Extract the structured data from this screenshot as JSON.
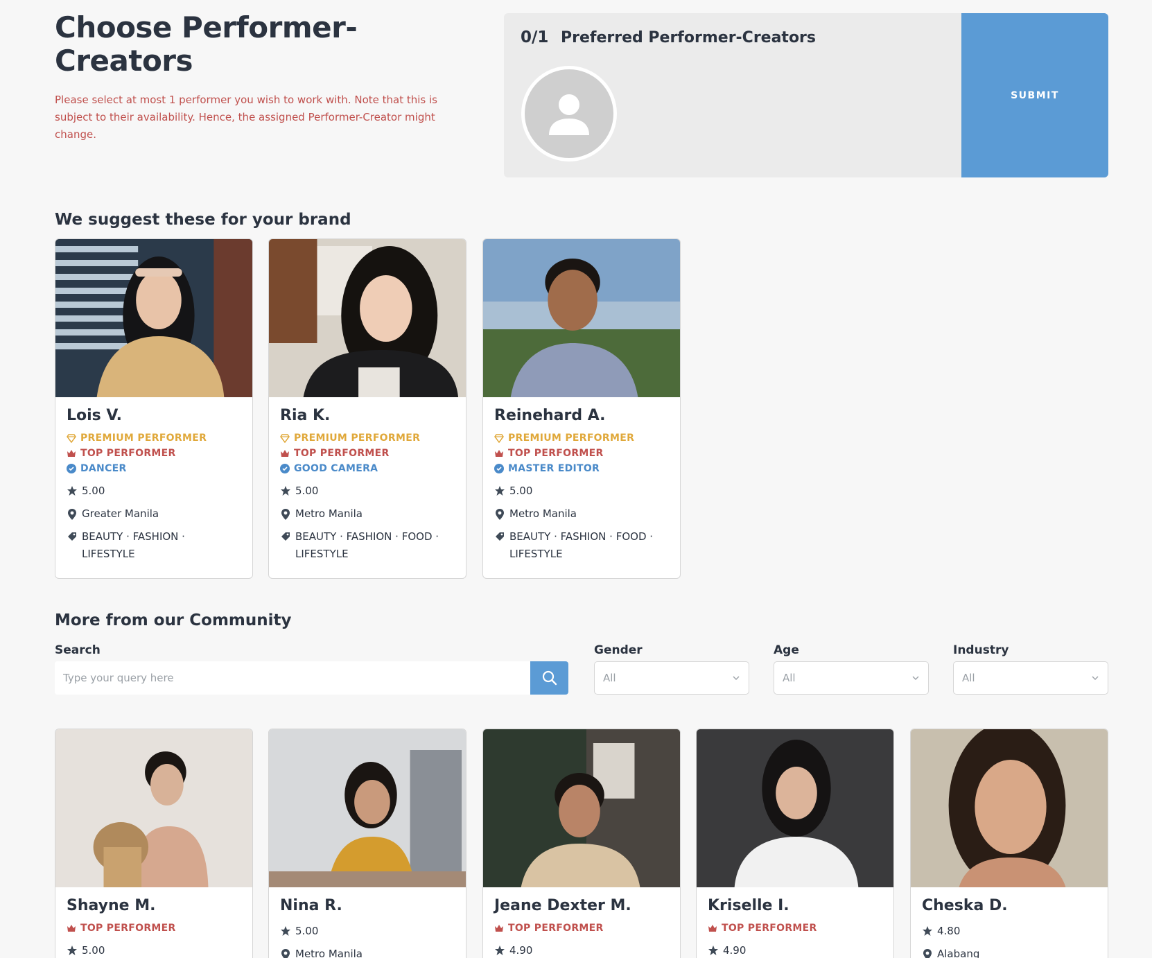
{
  "header": {
    "title": "Choose Performer-Creators",
    "notice": "Please select at most 1 performer you wish to work with. Note that this is subject to their availability. Hence, the assigned Performer-Creator might change."
  },
  "preferred": {
    "count": "0/1",
    "label": "Preferred Performer-Creators",
    "submit_label": "SUBMIT"
  },
  "suggested": {
    "title": "We suggest these for your brand",
    "cards": [
      {
        "name": "Lois V.",
        "premium": "PREMIUM PERFORMER",
        "top": "TOP PERFORMER",
        "skill": "DANCER",
        "rating": "5.00",
        "location": "Greater Manila",
        "tags": "BEAUTY · FASHION · LIFESTYLE"
      },
      {
        "name": "Ria K.",
        "premium": "PREMIUM PERFORMER",
        "top": "TOP PERFORMER",
        "skill": "GOOD CAMERA",
        "rating": "5.00",
        "location": "Metro Manila",
        "tags": "BEAUTY · FASHION · FOOD · LIFESTYLE"
      },
      {
        "name": "Reinehard A.",
        "premium": "PREMIUM PERFORMER",
        "top": "TOP PERFORMER",
        "skill": "MASTER EDITOR",
        "rating": "5.00",
        "location": "Metro Manila",
        "tags": "BEAUTY · FASHION · FOOD · LIFESTYLE"
      }
    ]
  },
  "community": {
    "title": "More from our Community",
    "search_label": "Search",
    "search_placeholder": "Type your query here",
    "gender_label": "Gender",
    "gender_value": "All",
    "age_label": "Age",
    "age_value": "All",
    "industry_label": "Industry",
    "industry_value": "All",
    "cards": [
      {
        "name": "Shayne M.",
        "top": "TOP PERFORMER",
        "rating": "5.00"
      },
      {
        "name": "Nina R.",
        "rating": "5.00",
        "location": "Metro Manila"
      },
      {
        "name": "Jeane Dexter M.",
        "top": "TOP PERFORMER",
        "rating": "4.90"
      },
      {
        "name": "Kriselle I.",
        "top": "TOP PERFORMER",
        "rating": "4.90"
      },
      {
        "name": "Cheska D.",
        "rating": "4.80",
        "location": "Alabang"
      }
    ]
  },
  "colors": {
    "accent": "#5b9bd5",
    "premium": "#e0a83a",
    "top": "#c0504d",
    "skill": "#4a8ac9",
    "text": "#2b3340"
  }
}
